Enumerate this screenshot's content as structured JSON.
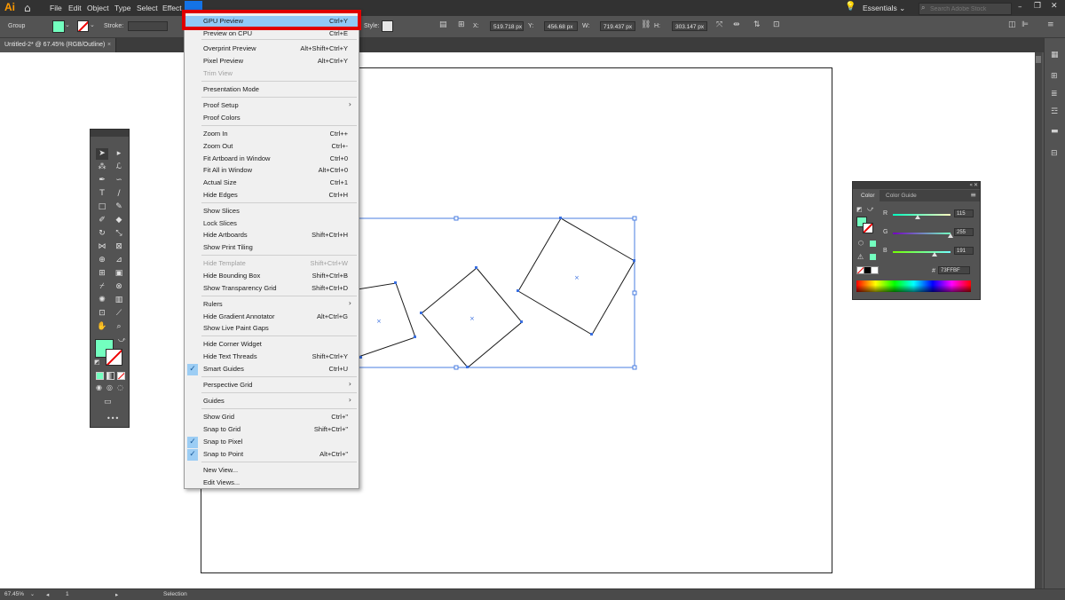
{
  "app": {
    "logo": "Ai",
    "home_icon": "home-icon"
  },
  "menubar": {
    "items": [
      "File",
      "Edit",
      "Object",
      "Type",
      "Select",
      "Effect"
    ],
    "workspace": "Essentials",
    "search_placeholder": "Search Adobe Stock"
  },
  "controlbar": {
    "selection_type": "Group",
    "stroke_label": "Stroke:",
    "style_label": "Style:",
    "x_label": "X:",
    "x_value": "519.718 px",
    "y_label": "Y:",
    "y_value": "456.68 px",
    "w_label": "W:",
    "w_value": "719.437 px",
    "h_label": "H:",
    "h_value": "303.147 px",
    "fill_color": "#73FFBF"
  },
  "document": {
    "tab_title": "Untitled-2* @ 67.45% (RGB/Outline)",
    "close": "×"
  },
  "status": {
    "zoom": "67.45%",
    "page": "1",
    "tool": "Selection"
  },
  "view_menu": {
    "items": [
      {
        "label": "GPU Preview",
        "shortcut": "Ctrl+Y",
        "highlight": true
      },
      {
        "label": "Preview on CPU",
        "shortcut": "Ctrl+E"
      },
      {
        "label": "Overprint Preview",
        "shortcut": "Alt+Shift+Ctrl+Y"
      },
      {
        "label": "Pixel Preview",
        "shortcut": "Alt+Ctrl+Y"
      },
      {
        "label": "Trim View",
        "shortcut": "",
        "disabled": true
      },
      {
        "label": "Presentation Mode",
        "shortcut": ""
      },
      {
        "label": "Proof Setup",
        "shortcut": "",
        "submenu": true
      },
      {
        "label": "Proof Colors",
        "shortcut": ""
      },
      {
        "label": "Zoom In",
        "shortcut": "Ctrl++"
      },
      {
        "label": "Zoom Out",
        "shortcut": "Ctrl+-"
      },
      {
        "label": "Fit Artboard in Window",
        "shortcut": "Ctrl+0"
      },
      {
        "label": "Fit All in Window",
        "shortcut": "Alt+Ctrl+0"
      },
      {
        "label": "Actual Size",
        "shortcut": "Ctrl+1"
      },
      {
        "label": "Hide Edges",
        "shortcut": "Ctrl+H"
      },
      {
        "label": "Show Slices",
        "shortcut": ""
      },
      {
        "label": "Lock Slices",
        "shortcut": ""
      },
      {
        "label": "Hide Artboards",
        "shortcut": "Shift+Ctrl+H"
      },
      {
        "label": "Show Print Tiling",
        "shortcut": ""
      },
      {
        "label": "Hide Template",
        "shortcut": "Shift+Ctrl+W",
        "disabled": true
      },
      {
        "label": "Hide Bounding Box",
        "shortcut": "Shift+Ctrl+B"
      },
      {
        "label": "Show Transparency Grid",
        "shortcut": "Shift+Ctrl+D"
      },
      {
        "label": "Rulers",
        "shortcut": "",
        "submenu": true
      },
      {
        "label": "Hide Gradient Annotator",
        "shortcut": "Alt+Ctrl+G"
      },
      {
        "label": "Show Live Paint Gaps",
        "shortcut": ""
      },
      {
        "label": "Hide Corner Widget",
        "shortcut": ""
      },
      {
        "label": "Hide Text Threads",
        "shortcut": "Shift+Ctrl+Y"
      },
      {
        "label": "Smart Guides",
        "shortcut": "Ctrl+U",
        "checked": true
      },
      {
        "label": "Perspective Grid",
        "shortcut": "",
        "submenu": true
      },
      {
        "label": "Guides",
        "shortcut": "",
        "submenu": true
      },
      {
        "label": "Show Grid",
        "shortcut": "Ctrl+\""
      },
      {
        "label": "Snap to Grid",
        "shortcut": "Shift+Ctrl+\""
      },
      {
        "label": "Snap to Pixel",
        "shortcut": "",
        "checked": true
      },
      {
        "label": "Snap to Point",
        "shortcut": "Alt+Ctrl+\"",
        "checked": true
      },
      {
        "label": "New View...",
        "shortcut": ""
      },
      {
        "label": "Edit Views...",
        "shortcut": ""
      }
    ]
  },
  "color_panel": {
    "tab_color": "Color",
    "tab_guide": "Color Guide",
    "r_label": "R",
    "r_value": "115",
    "g_label": "G",
    "g_value": "255",
    "b_label": "B",
    "b_value": "191",
    "hex_label": "#",
    "hex_value": "73FFBF",
    "fill_color": "#73FFBF"
  }
}
